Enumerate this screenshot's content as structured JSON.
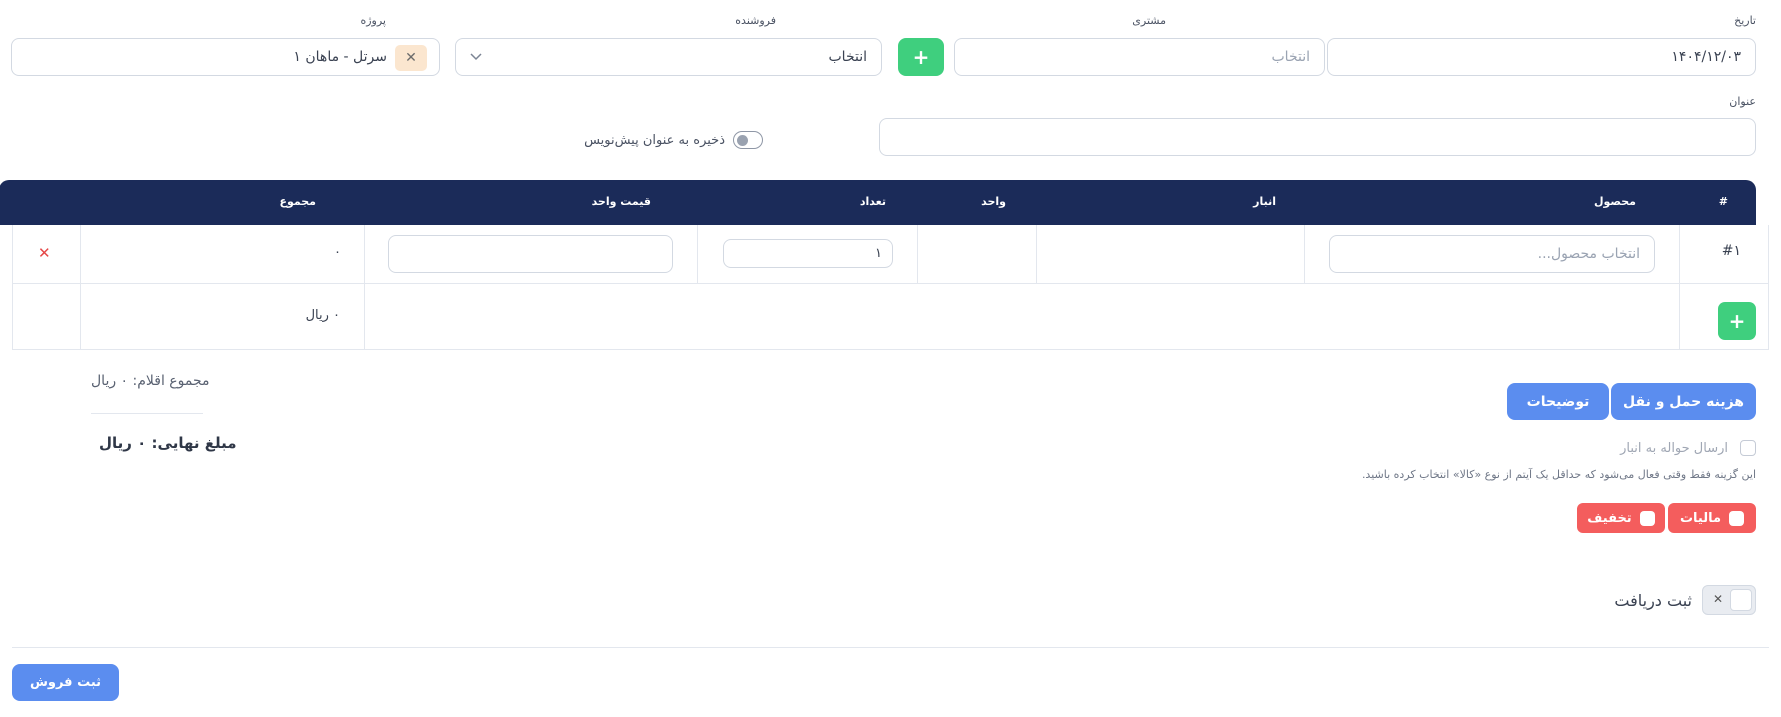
{
  "form": {
    "date": {
      "label": "تاریخ",
      "value": "۱۴۰۴/۱۲/۰۳"
    },
    "customer": {
      "label": "مشتری",
      "placeholder": "انتخاب",
      "add_icon": "plus-icon"
    },
    "seller": {
      "label": "فروشنده",
      "value": "انتخاب",
      "icon": "chevron-down-icon"
    },
    "project": {
      "label": "پروژه",
      "value": "سرتل - ماهان ۱",
      "clear_icon": "close-icon"
    },
    "title": {
      "label": "عنوان",
      "value": ""
    },
    "draft_toggle": {
      "label": "ذخیره به عنوان پیش‌نویس",
      "checked": false
    }
  },
  "table": {
    "headers": {
      "index": "#",
      "product": "محصول",
      "warehouse": "انبار",
      "unit": "واحد",
      "quantity": "تعداد",
      "unit_price": "قیمت واحد",
      "total": "مجموع"
    },
    "rows": [
      {
        "index": "#۱",
        "product_placeholder": "انتخاب محصول...",
        "warehouse": "",
        "unit": "",
        "quantity": "۱",
        "unit_price": "",
        "total": "۰",
        "delete_icon": "close-icon"
      }
    ],
    "footer": {
      "total": "۰ ریال",
      "add_icon": "plus-icon"
    }
  },
  "summary": {
    "items_total": "مجموع اقلام: ۰ ریال",
    "final_amount": "مبلغ نهایی: ۰ ریال"
  },
  "actions": {
    "shipping_cost": "هزینه حمل و نقل",
    "description": "توضیحات",
    "send_warehouse_label": "ارسال حواله به انبار",
    "send_warehouse_note": "این گزینه فقط وقتی فعال می‌شود که حداقل یک آیتم از نوع «کالا» انتخاب کرده باشید.",
    "tax": "مالیات",
    "discount": "تخفیف",
    "register_payment": "ثبت دریافت",
    "register_payment_icon": "close-icon",
    "submit_sale": "ثبت فروش"
  },
  "colors": {
    "table_header": "#1b2b59",
    "green": "#3fcf7e",
    "blue": "#5b8def",
    "red": "#f45d5d"
  }
}
